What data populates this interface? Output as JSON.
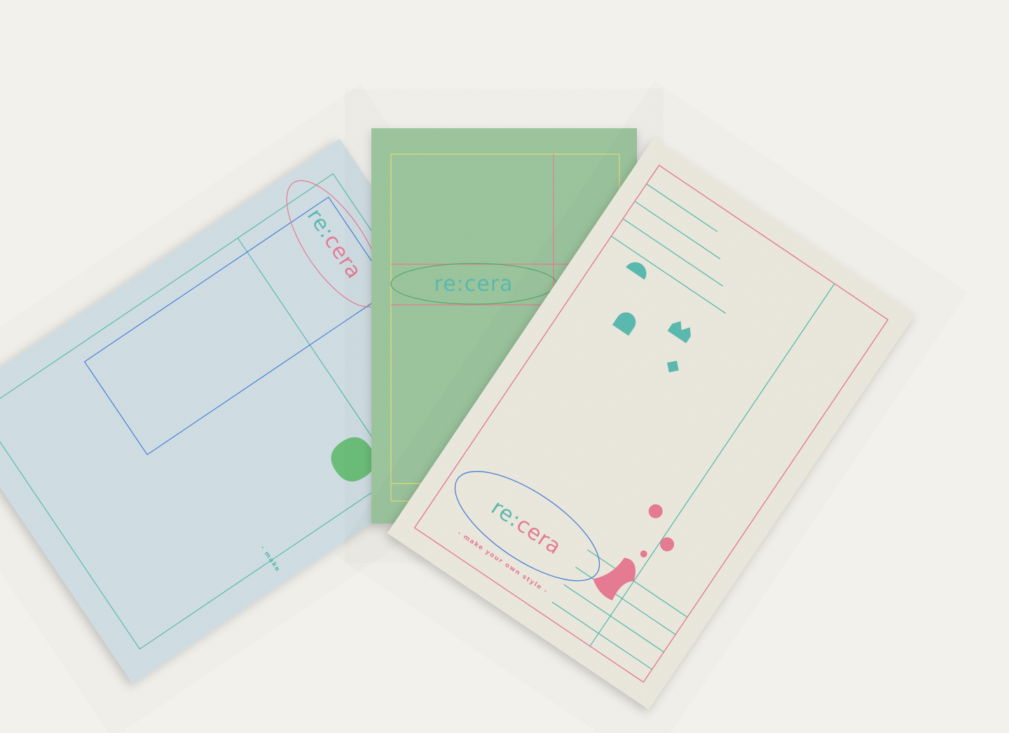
{
  "brand": {
    "logo_prefix": "re:",
    "logo_suffix": "cera",
    "tagline": "- make your own style -",
    "tagline_clipped": "- make"
  },
  "colors": {
    "background": "#f3f1ec",
    "card_blue": "#d2e0e6",
    "card_green": "#9dc79f",
    "card_cream": "#eceade",
    "teal": "#5bb8ae",
    "pink": "#e47b93",
    "blue_line": "#4a7fd2",
    "yellow_line": "#e3dc7a",
    "green_shape": "#6cbd7a"
  },
  "cards": [
    {
      "name": "blue-card",
      "color": "blue"
    },
    {
      "name": "green-card",
      "color": "green"
    },
    {
      "name": "cream-card",
      "color": "cream"
    }
  ]
}
